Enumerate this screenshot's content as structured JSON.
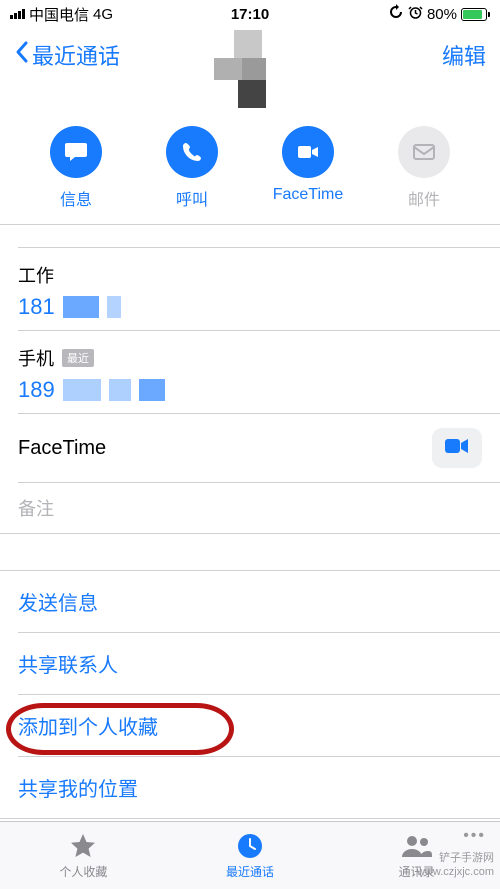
{
  "status": {
    "carrier": "中国电信",
    "network": "4G",
    "time": "17:10",
    "battery_pct": "80%"
  },
  "nav": {
    "back_label": "最近通话",
    "edit_label": "编辑"
  },
  "actions": {
    "message": "信息",
    "call": "呼叫",
    "facetime": "FaceTime",
    "mail": "邮件"
  },
  "phones": [
    {
      "label": "工作",
      "number_prefix": "181",
      "recent": false
    },
    {
      "label": "手机",
      "number_prefix": "189",
      "recent": true,
      "recent_badge": "最近"
    }
  ],
  "facetime_label": "FaceTime",
  "notes_placeholder": "备注",
  "links": {
    "send_message": "发送信息",
    "share_contact": "共享联系人",
    "add_favorite": "添加到个人收藏",
    "share_location": "共享我的位置"
  },
  "tabs": {
    "favorites": "个人收藏",
    "recents": "最近通话",
    "contacts": "通讯录"
  },
  "watermark": {
    "line1": "铲子手游网",
    "line2": "www.czjxjc.com"
  },
  "colors": {
    "accent": "#187afc",
    "highlight": "#b81414"
  }
}
